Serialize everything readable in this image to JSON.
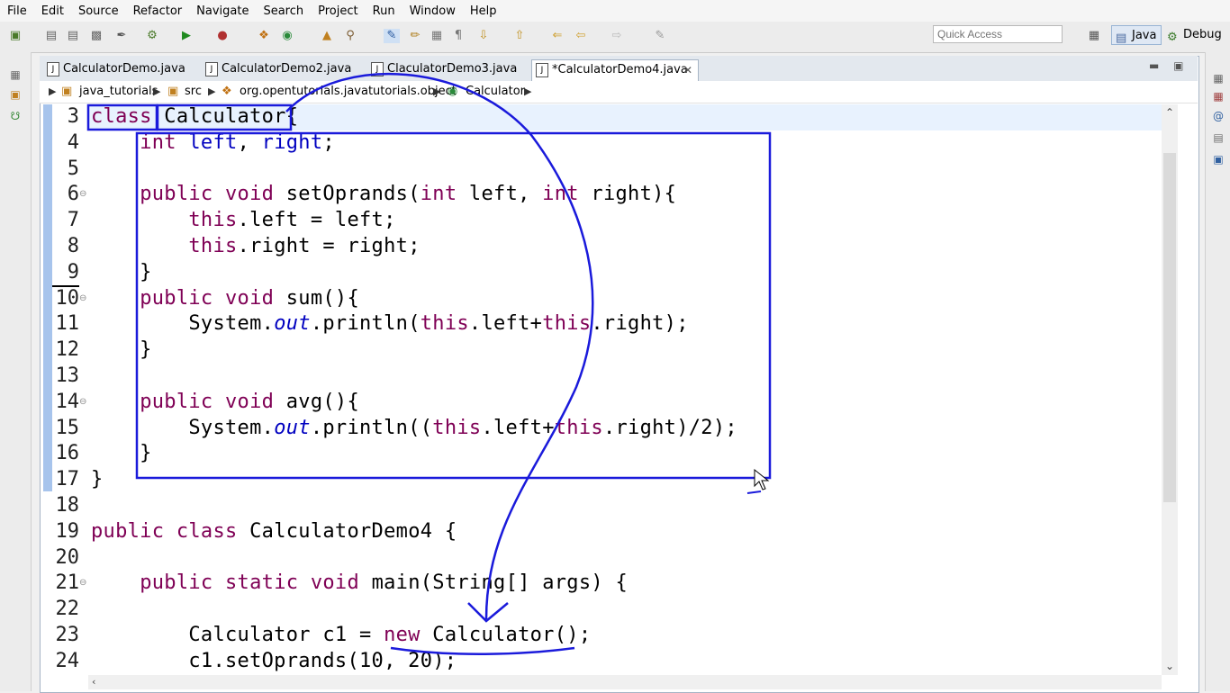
{
  "menu": [
    "File",
    "Edit",
    "Source",
    "Refactor",
    "Navigate",
    "Search",
    "Project",
    "Run",
    "Window",
    "Help"
  ],
  "quick_access": {
    "placeholder": "Quick Access"
  },
  "perspectives": {
    "java": "Java",
    "debug": "Debug"
  },
  "tabs": [
    {
      "label": "CalculatorDemo.java",
      "active": false
    },
    {
      "label": "CalculatorDemo2.java",
      "active": false
    },
    {
      "label": "ClaculatorDemo3.java",
      "active": false
    },
    {
      "label": "*CalculatorDemo4.java",
      "active": true
    }
  ],
  "breadcrumb": [
    "java_tutorials",
    "src",
    "org.opentutorials.javatutorials.object",
    "Calculator"
  ],
  "code_lines": [
    {
      "n": "3",
      "text": "class Calculator{"
    },
    {
      "n": "4",
      "text": "    int left, right;"
    },
    {
      "n": "5",
      "text": ""
    },
    {
      "n": "6",
      "text": "    public void setOprands(int left, int right){"
    },
    {
      "n": "7",
      "text": "        this.left = left;"
    },
    {
      "n": "8",
      "text": "        this.right = right;"
    },
    {
      "n": "9",
      "text": "    }"
    },
    {
      "n": "10",
      "text": "    public void sum(){"
    },
    {
      "n": "11",
      "text": "        System.out.println(this.left+this.right);"
    },
    {
      "n": "12",
      "text": "    }"
    },
    {
      "n": "13",
      "text": ""
    },
    {
      "n": "14",
      "text": "    public void avg(){"
    },
    {
      "n": "15",
      "text": "        System.out.println((this.left+this.right)/2);"
    },
    {
      "n": "16",
      "text": "    }"
    },
    {
      "n": "17",
      "text": "}"
    },
    {
      "n": "18",
      "text": ""
    },
    {
      "n": "19",
      "text": "public class CalculatorDemo4 {"
    },
    {
      "n": "20",
      "text": ""
    },
    {
      "n": "21",
      "text": "    public static void main(String[] args) {"
    },
    {
      "n": "22",
      "text": ""
    },
    {
      "n": "23",
      "text": "        Calculator c1 = new Calculator();"
    },
    {
      "n": "24",
      "text": "        c1.setOprands(10, 20);"
    }
  ],
  "colors": {
    "keyword": "#7f0055",
    "field": "#0000c0",
    "annotation": "#1a1adb",
    "current_line": "#e8f2fe"
  },
  "icons": {
    "new": "new-file-icon",
    "save": "save-icon",
    "run": "run-icon",
    "debug": "debug-icon",
    "java_perspective": "java-perspective-icon",
    "debug_perspective": "debug-perspective-icon"
  }
}
